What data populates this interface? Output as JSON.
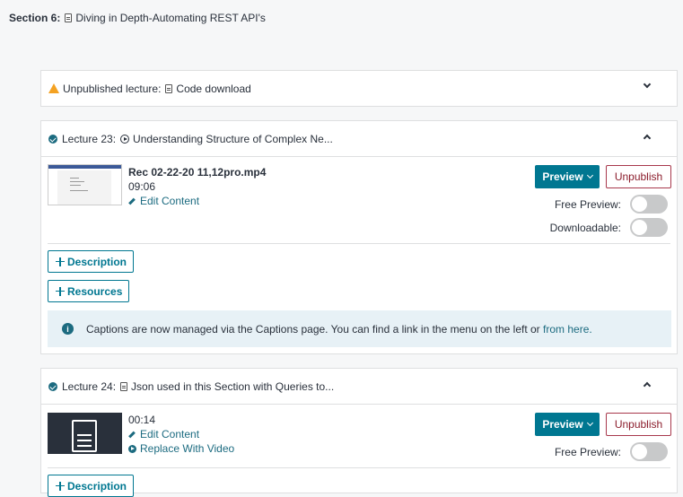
{
  "section": {
    "label": "Section 6:",
    "title": "Diving in Depth-Automating REST API's"
  },
  "unpublished": {
    "status": "Unpublished lecture:",
    "title": "Code download"
  },
  "lecture23": {
    "label": "Lecture 23:",
    "title": "Understanding Structure of Complex Ne...",
    "filename": "Rec 02-22-20 11,12pro.mp4",
    "duration": "09:06",
    "edit": "Edit Content",
    "preview": "Preview",
    "unpublish": "Unpublish",
    "free_preview": "Free Preview:",
    "downloadable": "Downloadable:",
    "description": "Description",
    "resources": "Resources",
    "info_text": "Captions are now managed via the Captions page. You can find a link in the menu on the left or ",
    "info_link": "from here."
  },
  "lecture24": {
    "label": "Lecture 24:",
    "title": "Json used in this Section with Queries to...",
    "duration": "00:14",
    "edit": "Edit Content",
    "replace": "Replace With Video",
    "preview": "Preview",
    "unpublish": "Unpublish",
    "free_preview": "Free Preview:",
    "description": "Description"
  },
  "colors": {
    "accent": "#007791",
    "unpublish": "#a8384c",
    "warning": "#f4a222",
    "info_bg": "#e7f1f6"
  },
  "icons": [
    "file-icon",
    "warning-icon",
    "check-circle-icon",
    "play-circle-icon",
    "chevron-up-icon",
    "chevron-down-icon",
    "pencil-icon",
    "plus-icon",
    "info-icon"
  ]
}
